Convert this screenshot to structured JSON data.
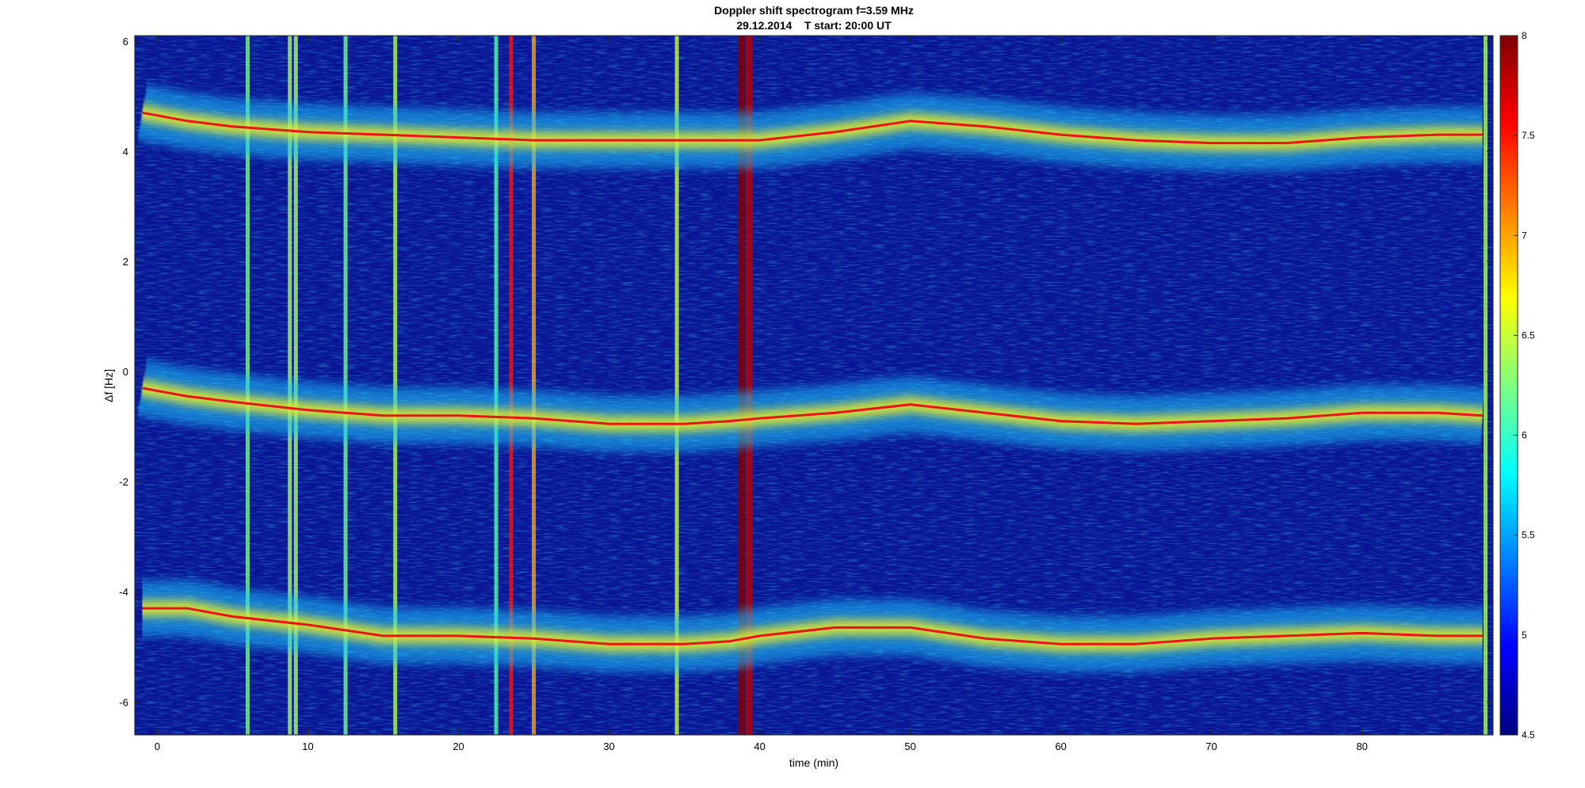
{
  "chart_data": {
    "type": "heatmap",
    "title": "Doppler shift spectrogram f=3.59 MHz",
    "subtitle": "29.12.2014    T start: 20:00 UT",
    "xlabel": "time (min)",
    "ylabel": "Δf [Hz]",
    "xlim": [
      -1.5,
      88.7
    ],
    "ylim": [
      -6.6,
      6.1
    ],
    "x_ticks": [
      "0",
      "10",
      "20",
      "30",
      "40",
      "50",
      "60",
      "70",
      "80"
    ],
    "y_ticks": [
      "6",
      "4",
      "2",
      "0",
      "-2",
      "-4",
      "-6"
    ],
    "colorbar": {
      "range": [
        4.5,
        8
      ],
      "ticks": [
        "8",
        "7.5",
        "7",
        "6.5",
        "6",
        "5.5",
        "5",
        "4.5"
      ],
      "colormap": "jet"
    },
    "grid": false,
    "traces": [
      {
        "x": [
          -1,
          0,
          2,
          5,
          10,
          15,
          20,
          25,
          30,
          35,
          38,
          40,
          45,
          50,
          55,
          60,
          65,
          70,
          75,
          80,
          85,
          88
        ],
        "y": [
          4.7,
          4.65,
          4.55,
          4.45,
          4.35,
          4.3,
          4.25,
          4.2,
          4.2,
          4.2,
          4.2,
          4.2,
          4.35,
          4.55,
          4.45,
          4.3,
          4.2,
          4.15,
          4.15,
          4.25,
          4.3,
          4.3
        ]
      },
      {
        "x": [
          -1,
          0,
          2,
          5,
          10,
          15,
          20,
          25,
          30,
          35,
          38,
          40,
          45,
          50,
          55,
          60,
          65,
          70,
          75,
          80,
          85,
          88
        ],
        "y": [
          -0.3,
          -0.35,
          -0.45,
          -0.55,
          -0.7,
          -0.8,
          -0.8,
          -0.85,
          -0.95,
          -0.95,
          -0.9,
          -0.85,
          -0.75,
          -0.6,
          -0.75,
          -0.9,
          -0.95,
          -0.9,
          -0.85,
          -0.75,
          -0.75,
          -0.8
        ]
      },
      {
        "x": [
          -1,
          0,
          2,
          5,
          10,
          15,
          20,
          25,
          30,
          35,
          38,
          40,
          45,
          50,
          55,
          60,
          65,
          70,
          75,
          80,
          85,
          88
        ],
        "y": [
          -4.3,
          -4.3,
          -4.3,
          -4.45,
          -4.6,
          -4.8,
          -4.8,
          -4.85,
          -4.95,
          -4.95,
          -4.9,
          -4.8,
          -4.65,
          -4.65,
          -4.85,
          -4.95,
          -4.95,
          -4.85,
          -4.8,
          -4.75,
          -4.8,
          -4.8
        ]
      }
    ],
    "vertical_interference_bands": [
      {
        "x": 6.0,
        "level": 6.2
      },
      {
        "x": 8.8,
        "level": 6.4
      },
      {
        "x": 9.2,
        "level": 6.4
      },
      {
        "x": 12.5,
        "level": 6.2
      },
      {
        "x": 15.8,
        "level": 6.4
      },
      {
        "x": 22.5,
        "level": 6.1
      },
      {
        "x": 23.5,
        "level": 7.5
      },
      {
        "x": 25.0,
        "level": 7.0
      },
      {
        "x": 34.5,
        "level": 6.5
      },
      {
        "x": 38.8,
        "level": 8.0
      },
      {
        "x": 39.3,
        "level": 7.8
      },
      {
        "x": 88.2,
        "level": 6.4
      }
    ]
  }
}
